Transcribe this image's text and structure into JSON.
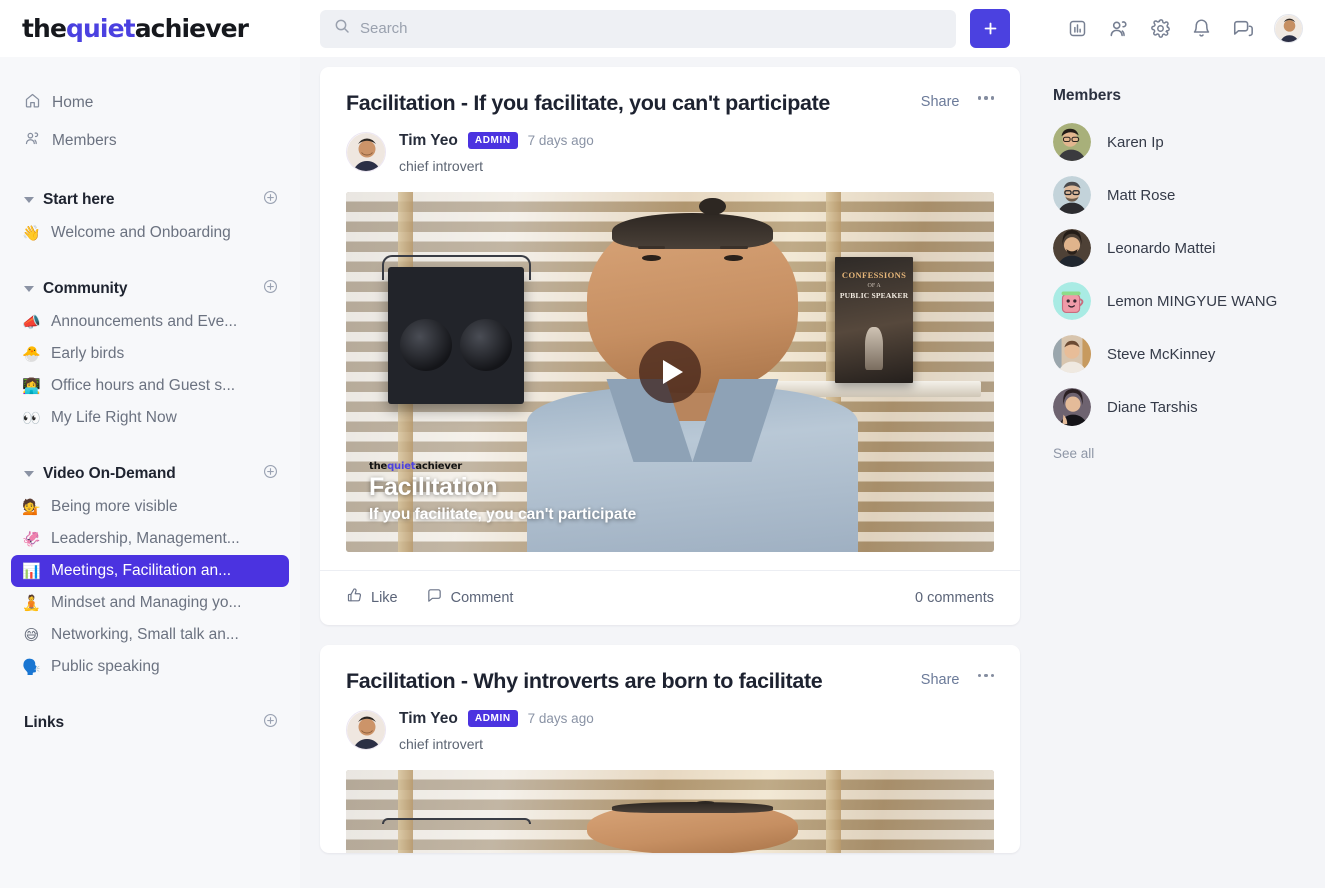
{
  "brand": {
    "logo_part1": "the",
    "logo_part2": "quiet",
    "logo_part3": "achiever",
    "accent_color": "#4b41e0",
    "active_color": "#4b33e0"
  },
  "topbar": {
    "search_placeholder": "Search",
    "search_value": "",
    "search_icon": "search-icon",
    "create_button_label": "+",
    "icons": [
      {
        "name": "analytics-icon",
        "label": "Analytics"
      },
      {
        "name": "members-icon",
        "label": "Members"
      },
      {
        "name": "settings-gear-icon",
        "label": "Settings"
      },
      {
        "name": "notifications-bell-icon",
        "label": "Notifications"
      },
      {
        "name": "messages-chat-icon",
        "label": "Messages"
      }
    ],
    "avatar_name": "user-avatar"
  },
  "sidebar": {
    "primary": [
      {
        "label": "Home",
        "icon": "home-icon"
      },
      {
        "label": "Members",
        "icon": "people-icon"
      }
    ],
    "sections": [
      {
        "title": "Start here",
        "collapsible": true,
        "add_icon": "plus-circle-icon",
        "items": [
          {
            "emoji": "👋",
            "label": "Welcome and Onboarding",
            "active": false
          }
        ]
      },
      {
        "title": "Community",
        "collapsible": true,
        "add_icon": "plus-circle-icon",
        "items": [
          {
            "emoji": "📣",
            "label": "Announcements and Eve...",
            "active": false
          },
          {
            "emoji": "🐣",
            "label": "Early birds",
            "active": false
          },
          {
            "emoji": "👩‍💻",
            "label": "Office hours and Guest s...",
            "active": false
          },
          {
            "emoji": "👀",
            "label": "My Life Right Now",
            "active": false
          }
        ]
      },
      {
        "title": "Video On-Demand",
        "collapsible": true,
        "add_icon": "plus-circle-icon",
        "items": [
          {
            "emoji": "💁",
            "label": "Being more visible",
            "active": false
          },
          {
            "emoji": "🦑",
            "label": "Leadership, Management...",
            "active": false
          },
          {
            "emoji": "📊",
            "label": "Meetings, Facilitation an...",
            "active": true
          },
          {
            "emoji": "🧘",
            "label": "Mindset and Managing yo...",
            "active": false
          },
          {
            "emoji": "😅",
            "label": "Networking, Small talk an...",
            "active": false
          },
          {
            "emoji": "🗣️",
            "label": "Public speaking",
            "active": false
          }
        ]
      },
      {
        "title": "Links",
        "collapsible": false,
        "add_icon": "plus-circle-icon",
        "items": []
      }
    ]
  },
  "feed": {
    "posts": [
      {
        "title": "Facilitation - If you facilitate, you can't participate",
        "share_label": "Share",
        "more_label": "More options",
        "author": {
          "name": "Tim Yeo",
          "badge": "ADMIN",
          "time": "7 days ago",
          "subtitle": "chief introvert"
        },
        "video": {
          "overlay_logo_1": "the",
          "overlay_logo_2": "quiet",
          "overlay_logo_3": "achiever",
          "overlay_title": "Facilitation",
          "overlay_subtitle": "If you facilitate, you can't participate",
          "book_line1": "CONFESSIONS",
          "book_line2": "OF A",
          "book_line3": "PUBLIC SPEAKER",
          "play_label": "Play video"
        },
        "actions": {
          "like_label": "Like",
          "comment_label": "Comment",
          "comment_count": "0 comments"
        }
      },
      {
        "title": "Facilitation - Why introverts are born to facilitate",
        "share_label": "Share",
        "more_label": "More options",
        "author": {
          "name": "Tim Yeo",
          "badge": "ADMIN",
          "time": "7 days ago",
          "subtitle": "chief introvert"
        }
      }
    ]
  },
  "members_panel": {
    "title": "Members",
    "see_all_label": "See all",
    "members": [
      {
        "name": "Karen Ip",
        "avatar_color": "#a8b07a"
      },
      {
        "name": "Matt Rose",
        "avatar_color": "#b9cdd4"
      },
      {
        "name": "Leonardo Mattei",
        "avatar_color": "#4e4136"
      },
      {
        "name": "Lemon MINGYUE WANG",
        "avatar_color": "#a9ebe4"
      },
      {
        "name": "Steve McKinney",
        "avatar_color": "#d8c5ae"
      },
      {
        "name": "Diane Tarshis",
        "avatar_color": "#6e6370"
      }
    ]
  }
}
